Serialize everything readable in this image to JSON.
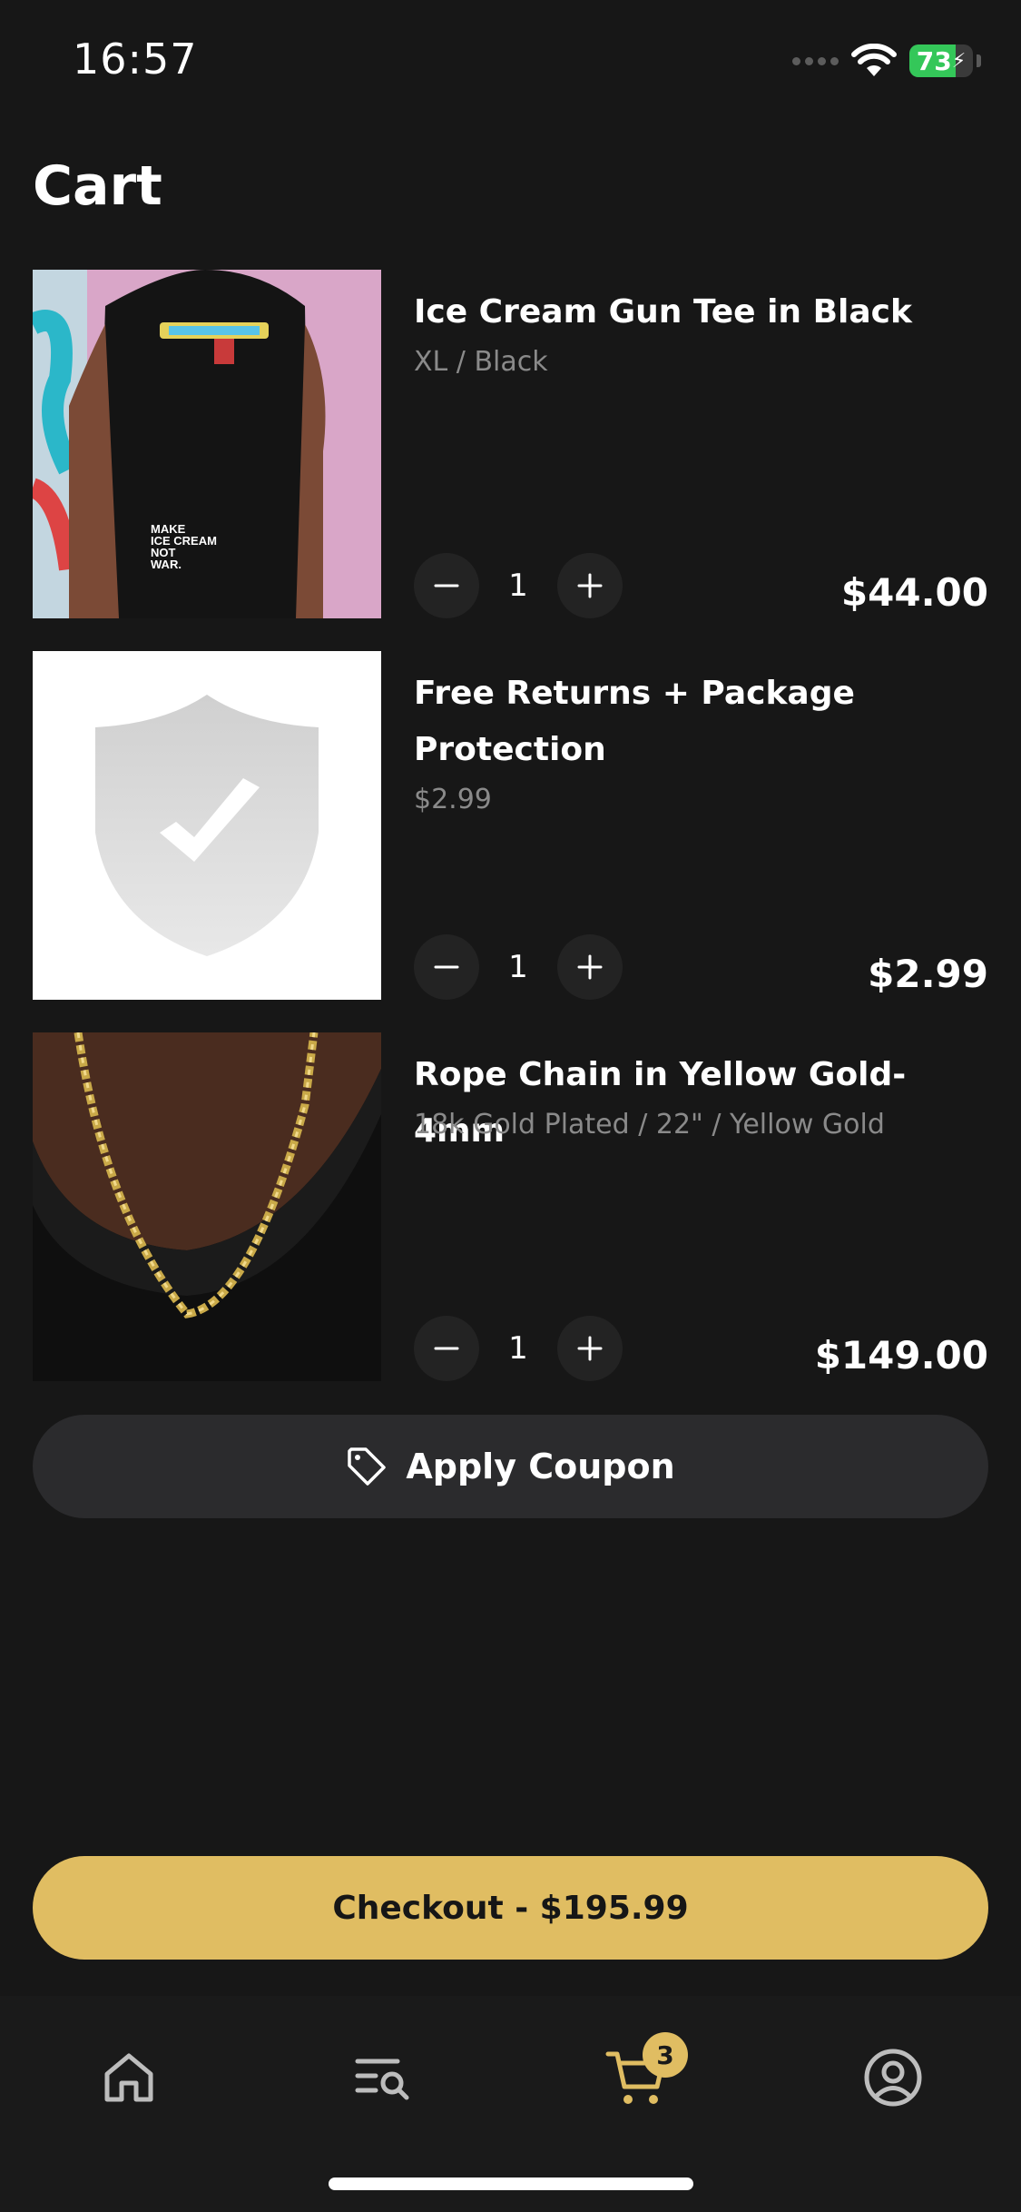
{
  "status_bar": {
    "time": "16:57",
    "battery": "73",
    "battery_level": 0.73
  },
  "page": {
    "title": "Cart"
  },
  "colors": {
    "accent": "#E0BD62",
    "background": "#171717",
    "surface": "#2B2B2D",
    "muted_text": "#8A8A8A"
  },
  "items": [
    {
      "name": "Ice Cream Gun Tee in Black",
      "variant": "XL / Black",
      "quantity": "1",
      "price": "$44.00",
      "image_icon": "tshirt-photo"
    },
    {
      "name": "Free Returns + Package Protection",
      "variant": "$2.99",
      "quantity": "1",
      "price": "$2.99",
      "image_icon": "shield-check-icon"
    },
    {
      "name": "Rope Chain in Yellow Gold- 4mm",
      "variant": "18k Gold Plated / 22\" / Yellow Gold",
      "quantity": "1",
      "price": "$149.00",
      "image_icon": "chain-photo"
    }
  ],
  "coupon": {
    "label": "Apply Coupon",
    "icon": "tag-icon"
  },
  "checkout": {
    "label": "Checkout - $195.99"
  },
  "tabbar": {
    "tabs": [
      {
        "name": "home",
        "icon": "home-icon"
      },
      {
        "name": "search",
        "icon": "search-list-icon"
      },
      {
        "name": "cart",
        "icon": "cart-icon",
        "badge": "3",
        "active": true
      },
      {
        "name": "account",
        "icon": "account-icon"
      }
    ]
  }
}
